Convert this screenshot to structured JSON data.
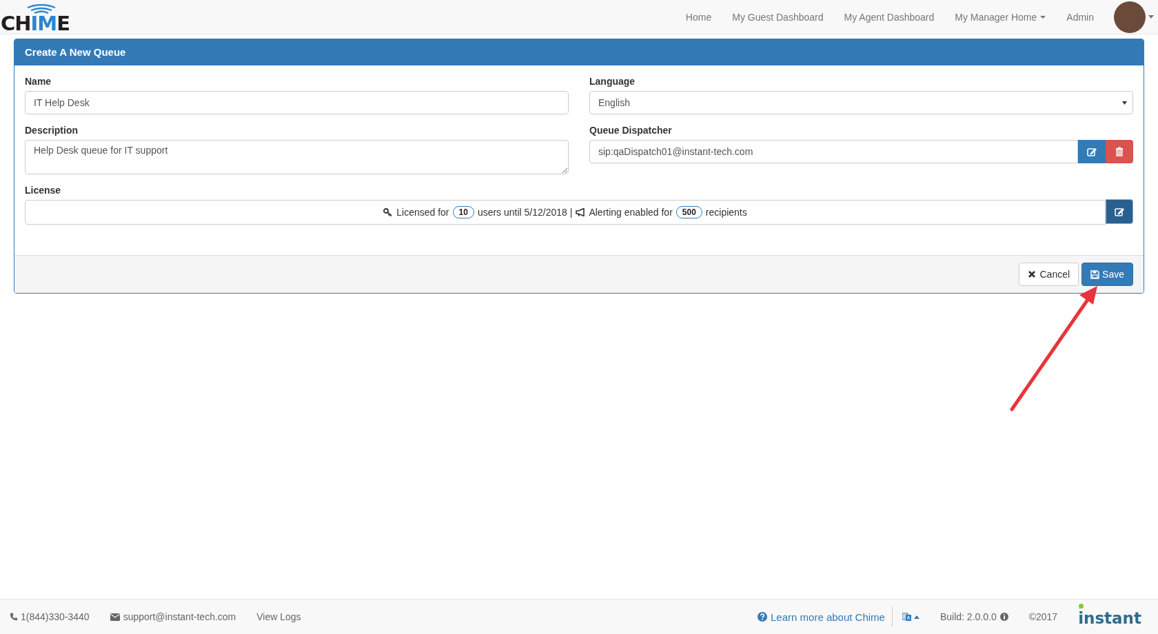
{
  "navbar": {
    "logo": [
      {
        "text": "CH",
        "accent": false
      },
      {
        "text": "IM",
        "accent": true
      },
      {
        "text": "E",
        "accent": false
      }
    ],
    "items": [
      {
        "label": "Home",
        "dropdown": false
      },
      {
        "label": "My Guest Dashboard",
        "dropdown": false
      },
      {
        "label": "My Agent Dashboard",
        "dropdown": false
      },
      {
        "label": "My Manager Home",
        "dropdown": true
      },
      {
        "label": "Admin",
        "dropdown": false
      }
    ]
  },
  "panel": {
    "title": "Create A New Queue",
    "name": {
      "label": "Name",
      "value": "IT Help Desk"
    },
    "language": {
      "label": "Language",
      "value": "English"
    },
    "description": {
      "label": "Description",
      "value": "Help Desk queue for IT support"
    },
    "dispatcher": {
      "label": "Queue Dispatcher",
      "value": "sip:qaDispatch01@instant-tech.com"
    },
    "license": {
      "label": "License",
      "text_1": "Licensed for",
      "users": "10",
      "text_2": "users until 5/12/2018 |",
      "text_3": "Alerting enabled for",
      "recipients": "500",
      "text_4": "recipients"
    },
    "buttons": [
      {
        "kind": "cancel",
        "label": "Cancel"
      },
      {
        "kind": "save",
        "label": "Save"
      }
    ]
  },
  "footer": {
    "phone": "1(844)330-3440",
    "email": "support@instant-tech.com",
    "view_logs": "View Logs",
    "learn_more": "Learn more about Chime",
    "build": "Build: 2.0.0.0",
    "copyright": "©2017",
    "brand": "instant"
  }
}
